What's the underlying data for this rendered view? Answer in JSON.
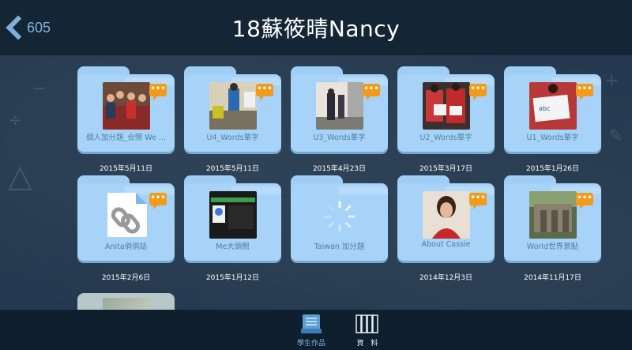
{
  "header": {
    "back_label": "605",
    "title": "18蘇筱晴Nancy"
  },
  "folders": [
    {
      "label": "個人加分題_合照 We ...",
      "date": "2015年5月11日",
      "thumb": "group-photo"
    },
    {
      "label": "U4_Words單字",
      "date": "2015年5月11日",
      "thumb": "classroom-photo"
    },
    {
      "label": "U3_Words單字",
      "date": "2015年4月23日",
      "thumb": "hallway-photo"
    },
    {
      "label": "U2_Words單字",
      "date": "2015年3月17日",
      "thumb": "students-paper-photo"
    },
    {
      "label": "U1_Words單字",
      "date": "2015年1月26日",
      "thumb": "card-photo"
    },
    {
      "label": "Anita俏俏話",
      "date": "2015年2月6日",
      "thumb": "link-file-icon"
    },
    {
      "label": "Me大頭照",
      "date": "2015年1月12日",
      "thumb": "screen-photo"
    },
    {
      "label": "Taiwan 加分題",
      "date": "",
      "thumb": "loading-spinner"
    },
    {
      "label": "About Cassie",
      "date": "2014年12月3日",
      "thumb": "portrait-photo"
    },
    {
      "label": "World世界景點",
      "date": "2014年11月17日",
      "thumb": "ruins-photo"
    }
  ],
  "comment_badge": "•••",
  "bottom_nav": [
    {
      "label": "學生作品",
      "icon": "student-works-icon",
      "active": true
    },
    {
      "label": "資　料",
      "icon": "binders-icon",
      "active": false
    }
  ],
  "colors": {
    "background": "#24394f",
    "header": "#142536",
    "folder": "#a6d3f7",
    "accent": "#7fb0dd",
    "badge": "#f39a1a"
  }
}
